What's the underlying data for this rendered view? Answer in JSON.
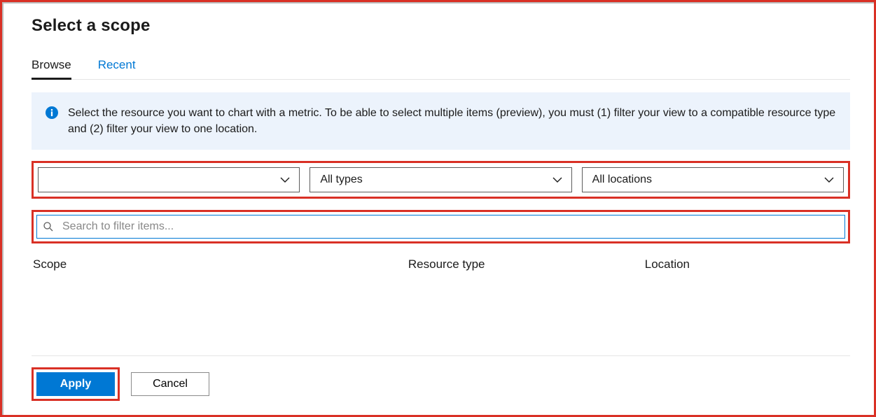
{
  "dialog": {
    "title": "Select a scope",
    "tabs": [
      {
        "label": "Browse",
        "active": true
      },
      {
        "label": "Recent",
        "active": false
      }
    ],
    "info_message": "Select the resource you want to chart with a metric. To be able to select multiple items (preview), you must (1) filter your view to a compatible resource type and (2) filter your view to one location.",
    "filters": {
      "subscription": {
        "value": ""
      },
      "type": {
        "value": "All types"
      },
      "location": {
        "value": "All locations"
      }
    },
    "search": {
      "placeholder": "Search to filter items...",
      "value": ""
    },
    "columns": {
      "scope": "Scope",
      "resource_type": "Resource type",
      "location": "Location"
    },
    "buttons": {
      "apply": "Apply",
      "cancel": "Cancel"
    }
  },
  "colors": {
    "accent": "#0078d4",
    "highlight_border": "#d93025",
    "info_bg": "#ecf3fc"
  }
}
